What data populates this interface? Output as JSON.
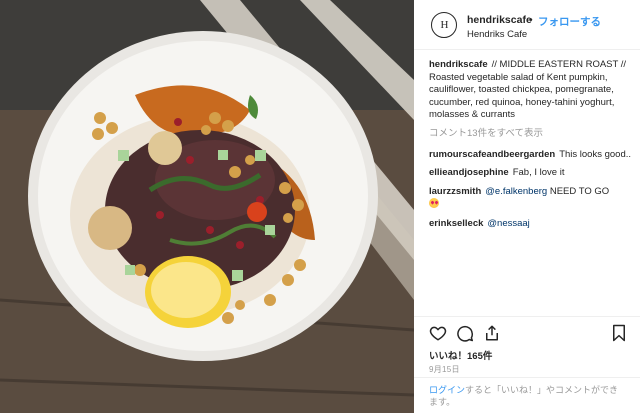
{
  "post": {
    "photo_alt": "Roasted vegetable salad on a white plate",
    "logo_letter": "H"
  },
  "header": {
    "username": "hendrikscafe",
    "separator": "•",
    "follow_label": "フォローする",
    "location": "Hendriks Cafe"
  },
  "caption": {
    "username": "hendrikscafe",
    "text": "// MIDDLE EASTERN ROAST // Roasted vegetable salad of Kent pumpkin, cauliflower, toasted chickpea, pomegranate, cucumber, red quinoa, honey-tahini yoghurt, molasses & currants"
  },
  "view_all_comments": "コメント13件をすべて表示",
  "comments": [
    {
      "username": "rumourscafeandbeergarden",
      "text": "This looks good.."
    },
    {
      "username": "ellieandjosephine",
      "text": "Fab, I love it"
    },
    {
      "username": "laurzzsmith",
      "mention": "@e.falkenberg",
      "text": "NEED TO GO",
      "icon": "heart-eyes-emoji"
    },
    {
      "username": "erinkselleck",
      "mention": "@nessaaj",
      "text": ""
    }
  ],
  "actions": {
    "likes": "いいね！165件",
    "date": "9月15日",
    "icons": [
      "heart-icon",
      "comment-icon",
      "share-icon",
      "bookmark-icon"
    ]
  },
  "login": {
    "link": "ログイン",
    "prompt": "すると「いいね！」やコメントができます。"
  },
  "colors": {
    "link_blue": "#3897f0",
    "text": "#262626",
    "muted": "#999999",
    "divider": "#efefef"
  }
}
